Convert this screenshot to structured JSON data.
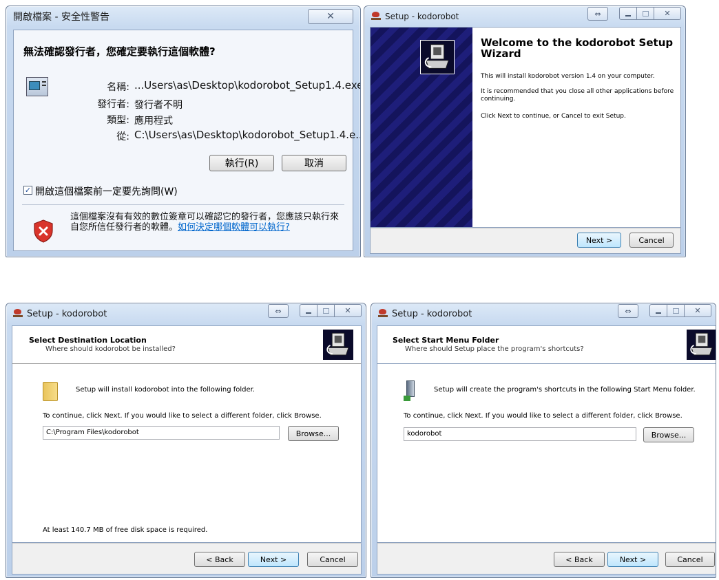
{
  "security_dialog": {
    "title": "開啟檔案 - 安全性警告",
    "question": "無法確認發行者，您確定要執行這個軟體?",
    "fields": [
      {
        "label": "名稱:",
        "value": "...Users\\as\\Desktop\\kodorobot_Setup1.4.exe"
      },
      {
        "label": "發行者:",
        "value": "發行者不明"
      },
      {
        "label": "類型:",
        "value": "應用程式"
      },
      {
        "label": "從:",
        "value": "C:\\Users\\as\\Desktop\\kodorobot_Setup1.4.e..."
      }
    ],
    "run_button": "執行(R)",
    "cancel_button": "取消",
    "checkbox_label": "開啟這個檔案前一定要先詢問(W)",
    "checkbox_checked": true,
    "warning_text": "這個檔案沒有有效的數位簽章可以確認它的發行者，您應該只執行來自您所信任發行者的軟體。",
    "warning_link": "如何決定哪個軟體可以執行?"
  },
  "welcome_wizard": {
    "title": "Setup - kodorobot",
    "heading": "Welcome to the kodorobot Setup Wizard",
    "line1": "This will install kodorobot version 1.4 on your computer.",
    "line2": "It is recommended that you close all other applications before continuing.",
    "line3": "Click Next to continue, or Cancel to exit Setup.",
    "next_button": "Next >",
    "cancel_button": "Cancel"
  },
  "destination_wizard": {
    "title": "Setup - kodorobot",
    "heading": "Select Destination Location",
    "subheading": "Where should kodorobot be installed?",
    "install_line": "Setup will install kodorobot into the following folder.",
    "instructions": "To continue, click Next. If you would like to select a different folder, click Browse.",
    "path_value": "C:\\Program Files\\kodorobot",
    "browse_button": "Browse...",
    "disk_space": "At least 140.7 MB of free disk space is required.",
    "back_button": "< Back",
    "next_button": "Next >",
    "cancel_button": "Cancel"
  },
  "startmenu_wizard": {
    "title": "Setup - kodorobot",
    "heading": "Select Start Menu Folder",
    "subheading": "Where should Setup place the program's shortcuts?",
    "create_line": "Setup will create the program's shortcuts in the following Start Menu folder.",
    "instructions": "To continue, click Next. If you would like to select a different folder, click Browse.",
    "folder_value": "kodorobot",
    "browse_button": "Browse...",
    "back_button": "< Back",
    "next_button": "Next >",
    "cancel_button": "Cancel"
  },
  "colors": {
    "title_bar": "#c8daf0",
    "wizard_sidebar": "#1a1a6e",
    "link": "#0066cc",
    "shield_red": "#d9342b"
  }
}
